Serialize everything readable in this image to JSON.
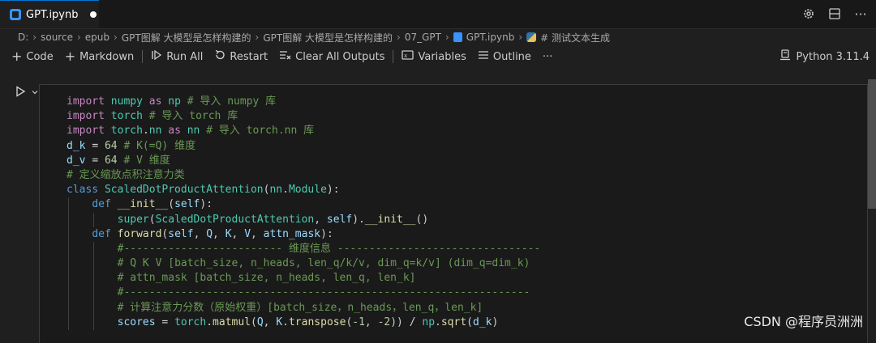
{
  "tab": {
    "title": "GPT.ipynb"
  },
  "breadcrumb": [
    "D:",
    "source",
    "epub",
    "GPT图解 大模型是怎样构建的",
    "GPT图解 大模型是怎样构建的",
    "07_GPT",
    "GPT.ipynb",
    "# 测试文本生成"
  ],
  "toolbar": {
    "code": "Code",
    "markdown": "Markdown",
    "run_all": "Run All",
    "restart": "Restart",
    "clear_outputs": "Clear All Outputs",
    "variables": "Variables",
    "outline": "Outline",
    "more": "···",
    "kernel": "Python 3.11.4"
  },
  "watermark": "CSDN @程序员洲洲"
}
